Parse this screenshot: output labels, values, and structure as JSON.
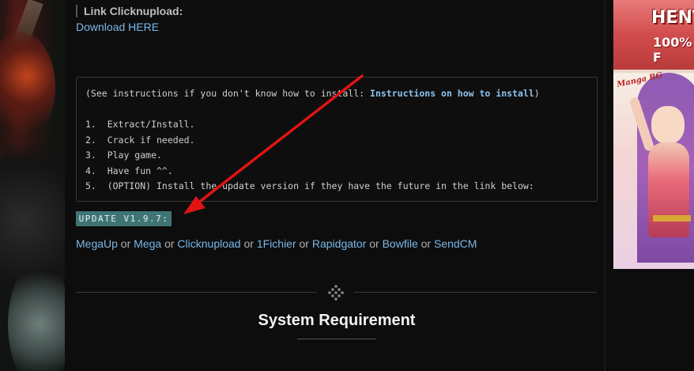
{
  "download_section": {
    "label": "Link Clicknupload:",
    "link_text": "Download HERE"
  },
  "instructions_box": {
    "intro_prefix": "(See instructions if you don't know how to install: ",
    "intro_link": "Instructions on how to install",
    "intro_suffix": ")",
    "steps": [
      "1.  Extract/Install.",
      "2.  Crack if needed.",
      "3.  Play game.",
      "4.  Have fun ^^.",
      "5.  (OPTION) Install the update version if they have the future in the link below:"
    ]
  },
  "update_badge": "UPDATE V1.9.7:",
  "mirrors": {
    "separator": " or ",
    "links": [
      "MegaUp",
      "Mega",
      "Clicknupload",
      "1Fichier",
      "Rapidgator",
      "Bowfile",
      "SendCM"
    ]
  },
  "system_requirement_title": "System Requirement",
  "ad": {
    "title_text": "HENT",
    "subtitle_text": "100% F",
    "logo_text": "Manga RG"
  },
  "colors": {
    "link": "#7ab8e8",
    "badge_bg": "#3f7474",
    "arrow": "#e01414"
  }
}
